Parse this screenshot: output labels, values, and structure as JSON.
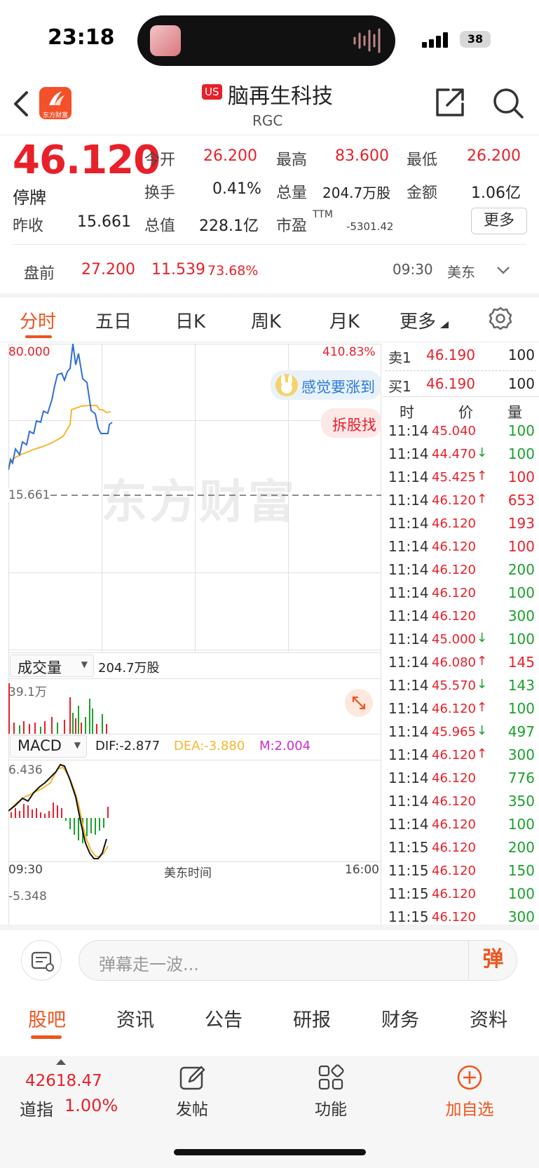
{
  "status_bar": {
    "time": "23:18",
    "battery": "38"
  },
  "header": {
    "market_badge": "US",
    "title": "脑再生科技",
    "ticker": "RGC",
    "logo_text": "东方财富"
  },
  "quote": {
    "price": "46.120",
    "suspended": "停牌",
    "open_label": "今开",
    "open": "26.200",
    "high_label": "最高",
    "high": "83.600",
    "low_label": "最低",
    "low": "26.200",
    "turnover_label": "换手",
    "turnover": "0.41%",
    "volume_label": "总量",
    "volume": "204.7万股",
    "amount_label": "金额",
    "amount": "1.06亿",
    "prev_close_label": "昨收",
    "prev_close": "15.661",
    "mcap_label": "总值",
    "mcap": "228.1亿",
    "pe_label": "市盈",
    "pe_sup": "TTM",
    "pe": "-5301.42",
    "more_button": "更多"
  },
  "premarket": {
    "label": "盘前",
    "price": "27.200",
    "change": "11.539",
    "change_pct": "73.68%",
    "time": "09:30",
    "tz": "美东"
  },
  "chart_tabs": [
    "分时",
    "五日",
    "日K",
    "周K",
    "月K",
    "更多"
  ],
  "chart": {
    "y_max": "80.000",
    "pct_max": "410.83%",
    "prev_close": "15.661",
    "bubble1": "感觉要涨到",
    "bubble2": "拆股找",
    "watermark": "东方财富",
    "volume_label": "成交量",
    "volume_total": "204.7万股",
    "volume_max": "39.1万",
    "macd_label": "MACD",
    "dif": "DIF:-2.877",
    "dea": "DEA:-3.880",
    "m": "M:2.004",
    "macd_max": "6.436",
    "macd_min": "-5.348",
    "x_start": "09:30",
    "x_mid": "美东时间",
    "x_end": "16:00",
    "colors": {
      "price_line": "#2f6fd6",
      "avg_line": "#f5b731",
      "up": "#e8202a",
      "down": "#1aa12b"
    }
  },
  "order_book": {
    "ask_label": "卖1",
    "ask_price": "46.190",
    "ask_vol": "100",
    "bid_label": "买1",
    "bid_price": "46.190",
    "bid_vol": "100",
    "headers": [
      "时",
      "价",
      "量"
    ]
  },
  "trades": [
    {
      "t": "11:14",
      "p": "45.040",
      "dir": "",
      "v": "100",
      "pc": "red",
      "vc": "green"
    },
    {
      "t": "11:14",
      "p": "44.470",
      "dir": "↓",
      "v": "100",
      "pc": "red",
      "vc": "green"
    },
    {
      "t": "11:14",
      "p": "45.425",
      "dir": "↑",
      "v": "100",
      "pc": "red",
      "vc": "red"
    },
    {
      "t": "11:14",
      "p": "46.120",
      "dir": "↑",
      "v": "653",
      "pc": "red",
      "vc": "red"
    },
    {
      "t": "11:14",
      "p": "46.120",
      "dir": "",
      "v": "193",
      "pc": "red",
      "vc": "red"
    },
    {
      "t": "11:14",
      "p": "46.120",
      "dir": "",
      "v": "100",
      "pc": "red",
      "vc": "red"
    },
    {
      "t": "11:14",
      "p": "46.120",
      "dir": "",
      "v": "200",
      "pc": "red",
      "vc": "green"
    },
    {
      "t": "11:14",
      "p": "46.120",
      "dir": "",
      "v": "100",
      "pc": "red",
      "vc": "green"
    },
    {
      "t": "11:14",
      "p": "46.120",
      "dir": "",
      "v": "300",
      "pc": "red",
      "vc": "green"
    },
    {
      "t": "11:14",
      "p": "45.000",
      "dir": "↓",
      "v": "100",
      "pc": "red",
      "vc": "green"
    },
    {
      "t": "11:14",
      "p": "46.080",
      "dir": "↑",
      "v": "145",
      "pc": "red",
      "vc": "red"
    },
    {
      "t": "11:14",
      "p": "45.570",
      "dir": "↓",
      "v": "143",
      "pc": "red",
      "vc": "green"
    },
    {
      "t": "11:14",
      "p": "46.120",
      "dir": "↑",
      "v": "100",
      "pc": "red",
      "vc": "green"
    },
    {
      "t": "11:14",
      "p": "45.965",
      "dir": "↓",
      "v": "497",
      "pc": "red",
      "vc": "green"
    },
    {
      "t": "11:14",
      "p": "46.120",
      "dir": "↑",
      "v": "300",
      "pc": "red",
      "vc": "green"
    },
    {
      "t": "11:14",
      "p": "46.120",
      "dir": "",
      "v": "776",
      "pc": "red",
      "vc": "green"
    },
    {
      "t": "11:14",
      "p": "46.120",
      "dir": "",
      "v": "350",
      "pc": "red",
      "vc": "green"
    },
    {
      "t": "11:14",
      "p": "46.120",
      "dir": "",
      "v": "100",
      "pc": "red",
      "vc": "green"
    },
    {
      "t": "11:15",
      "p": "46.120",
      "dir": "",
      "v": "200",
      "pc": "red",
      "vc": "green"
    },
    {
      "t": "11:15",
      "p": "46.120",
      "dir": "",
      "v": "150",
      "pc": "red",
      "vc": "green"
    },
    {
      "t": "11:15",
      "p": "46.120",
      "dir": "",
      "v": "100",
      "pc": "red",
      "vc": "green"
    },
    {
      "t": "11:15",
      "p": "46.120",
      "dir": "",
      "v": "300",
      "pc": "red",
      "vc": "green"
    }
  ],
  "comment": {
    "placeholder": "弹幕走一波...",
    "danmu": "弹"
  },
  "sub_tabs": [
    "股吧",
    "资讯",
    "公告",
    "研报",
    "财务",
    "资料"
  ],
  "toolbar": {
    "index_value": "42618.47",
    "index_name": "道指",
    "index_change": "1.00%",
    "post": "发帖",
    "features": "功能",
    "add_watch": "加自选"
  }
}
